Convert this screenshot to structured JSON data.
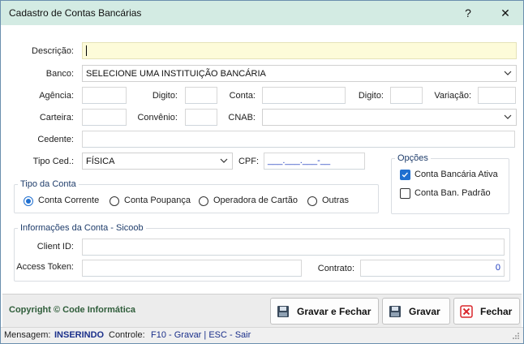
{
  "window": {
    "title": "Cadastro de Contas Bancárias",
    "help_label": "?",
    "close_label": "✕"
  },
  "form": {
    "descricao_label": "Descrição:",
    "descricao_value": "",
    "banco_label": "Banco:",
    "banco_value": "SELECIONE UMA INSTITUIÇÃO BANCÁRIA",
    "agencia_label": "Agência:",
    "agencia_digito_label": "Digito:",
    "conta_label": "Conta:",
    "conta_digito_label": "Digito:",
    "variacao_label": "Variação:",
    "carteira_label": "Carteira:",
    "convenio_label": "Convênio:",
    "cnab_label": "CNAB:",
    "cnab_value": "",
    "cedente_label": "Cedente:",
    "tipo_ced_label": "Tipo Ced.:",
    "tipo_ced_value": "FÍSICA",
    "cpf_label": "CPF:",
    "cpf_value": "___.___.___-__"
  },
  "opcoes": {
    "title": "Opções",
    "conta_ativa_label": "Conta Bancária Ativa",
    "conta_ativa_checked": true,
    "conta_padrao_label": "Conta Ban. Padrão",
    "conta_padrao_checked": false
  },
  "tipo_conta": {
    "title": "Tipo da Conta",
    "options": [
      "Conta Corrente",
      "Conta Poupança",
      "Operadora de Cartão",
      "Outras"
    ],
    "selected": "Conta Corrente"
  },
  "informacoes": {
    "title": "Informações da Conta - Sicoob",
    "client_id_label": "Client ID:",
    "access_token_label": "Access Token:",
    "contrato_label": "Contrato:",
    "contrato_value": "0"
  },
  "footer": {
    "copyright": "Copyright © Code Informática",
    "save_close_label": "Gravar e Fechar",
    "save_label": "Gravar",
    "close_label": "Fechar"
  },
  "status": {
    "mensagem_label": "Mensagem:",
    "mensagem_value": "INSERINDO",
    "controle_label": "Controle:",
    "controle_value": "F10 - Gravar | ESC - Sair"
  },
  "colors": {
    "titlebar": "#d3ebe3",
    "accent": "#1f6fd0",
    "group_title": "#1f3d6b",
    "copyright": "#2f5d3a",
    "status_value": "#1a2f8a",
    "close_icon": "#d9262c"
  }
}
